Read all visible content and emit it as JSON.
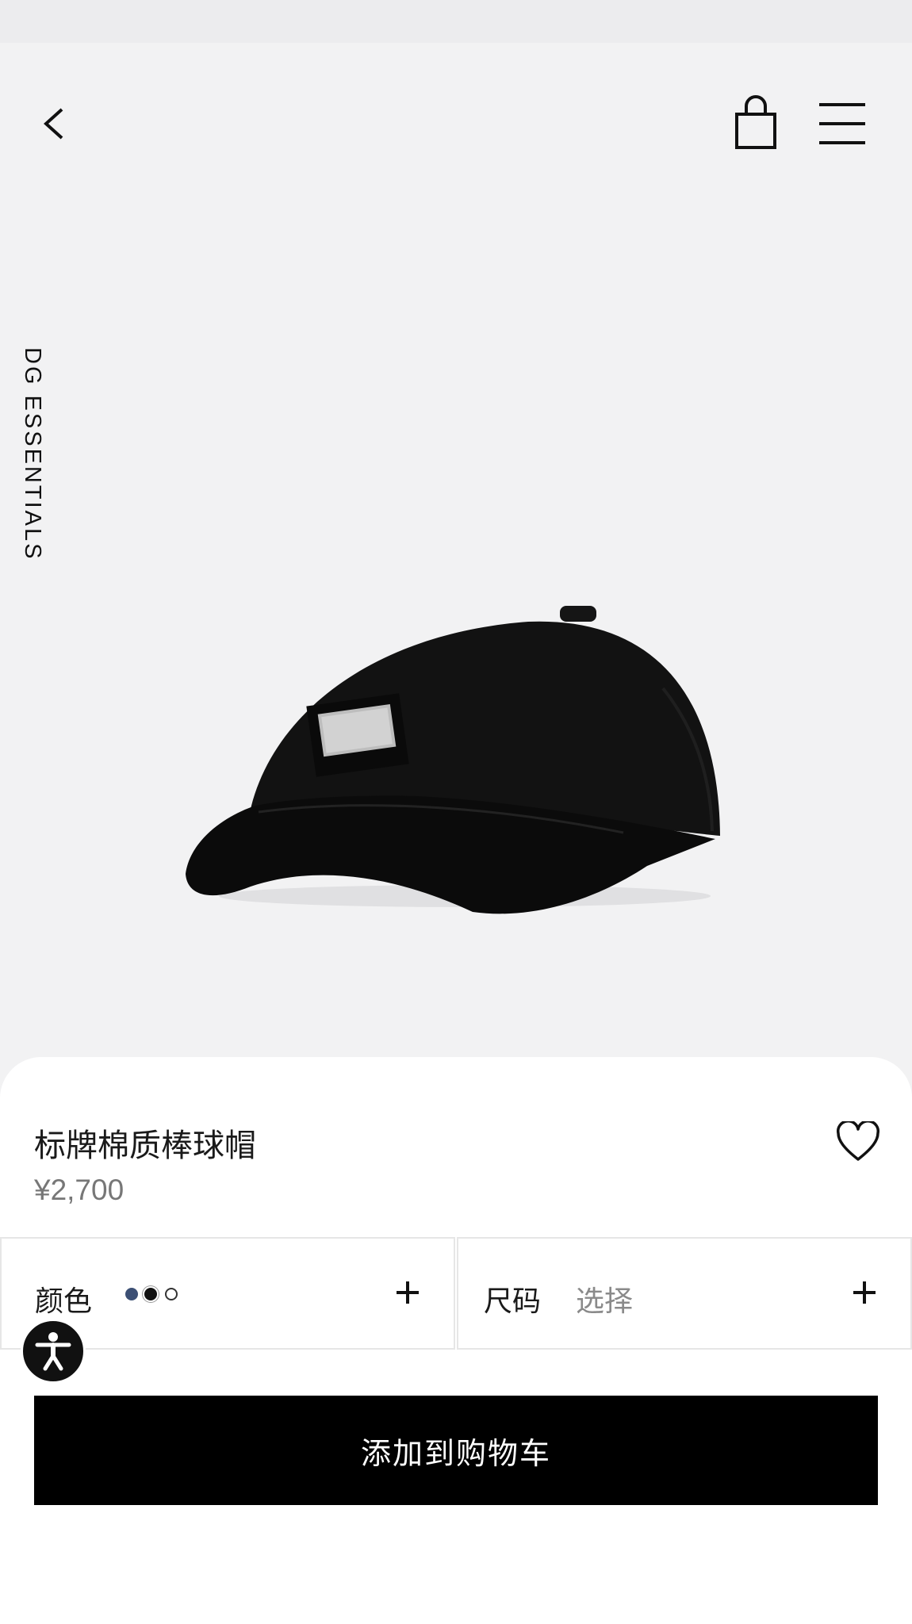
{
  "collection": {
    "label": "DG ESSENTIALS"
  },
  "product": {
    "title": "标牌棉质棒球帽",
    "price": "¥2,700",
    "image_alt": "black cotton baseball cap with metal logo plate"
  },
  "options": {
    "color": {
      "label": "颜色",
      "swatches": [
        {
          "name": "navy",
          "color": "#3c4f74"
        },
        {
          "name": "black",
          "color": "#111111"
        },
        {
          "name": "white",
          "color": "#ffffff"
        }
      ]
    },
    "size": {
      "label": "尺码",
      "placeholder": "选择"
    }
  },
  "cart": {
    "add_label": "添加到购物车"
  },
  "icons": {
    "back": "chevron-left-icon",
    "bag": "shopping-bag-icon",
    "menu": "hamburger-menu-icon",
    "favorite": "heart-icon",
    "expand": "plus-icon",
    "accessibility": "accessibility-icon"
  },
  "colors": {
    "accent": "#000000",
    "sheet": "#ffffff",
    "backdrop": "#f2f2f3"
  }
}
